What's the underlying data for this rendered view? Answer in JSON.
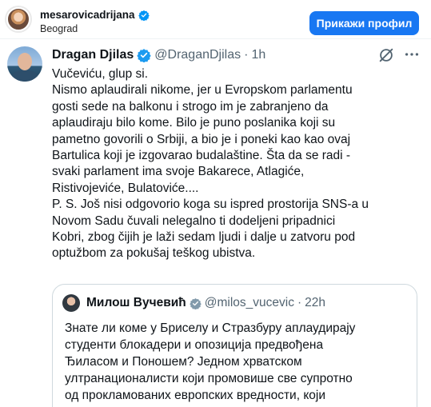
{
  "header": {
    "username": "mesarovicadrijana",
    "location": "Beograd",
    "profile_button": "Прикажи профил"
  },
  "tweet": {
    "name": "Dragan Djilas",
    "handle": "@DraganDjilas",
    "dot": "·",
    "time": "1h",
    "text": "Vučeviću, glup si.\nNismo aplaudirali nikome, jer u Evropskom parlamentu\ngosti sede na balkonu i strogo im je zabranjeno da\naplaudiraju bilo kome. Bilo je puno poslanika koji su\npametno govorili o Srbiji, a bio je i poneki kao kao ovaj\nBartulica koji je izgovarao budalaštine. Šta da se radi -\nsvaki parlament ima svoje Bakarece, Atlagiće,\nRistivojeviće, Bulatoviće....\nP. S. Još nisi odgovorio koga su  ispred prostorija SNS-a u\nNovom Sadu čuvali nelegalno ti dodeljeni pripadnici\nKobri,  zbog čijih je laži sedam ljudi i dalje u zatvoru pod\noptužbom za pokušaj teškog ubistva.",
    "quote": {
      "name": "Милош Вучевић",
      "handle": "@milos_vucevic",
      "dot": "·",
      "time": "22h",
      "text": "Знате ли коме у Бриселу и Стразбуру аплаудирају\nстуденти блокадери и опозиција предвођена\nЂиласом и Понoшем? Једном хрватском\nултранационалисти који промовише све супротно\nод прокламованих европских вредности, који"
    }
  },
  "colors": {
    "accent": "#1877f2",
    "verified": "#1d9bf0",
    "gold_verified": "#829aab"
  },
  "icons": [
    "verified-badge-icon",
    "grok-icon",
    "more-icon"
  ]
}
